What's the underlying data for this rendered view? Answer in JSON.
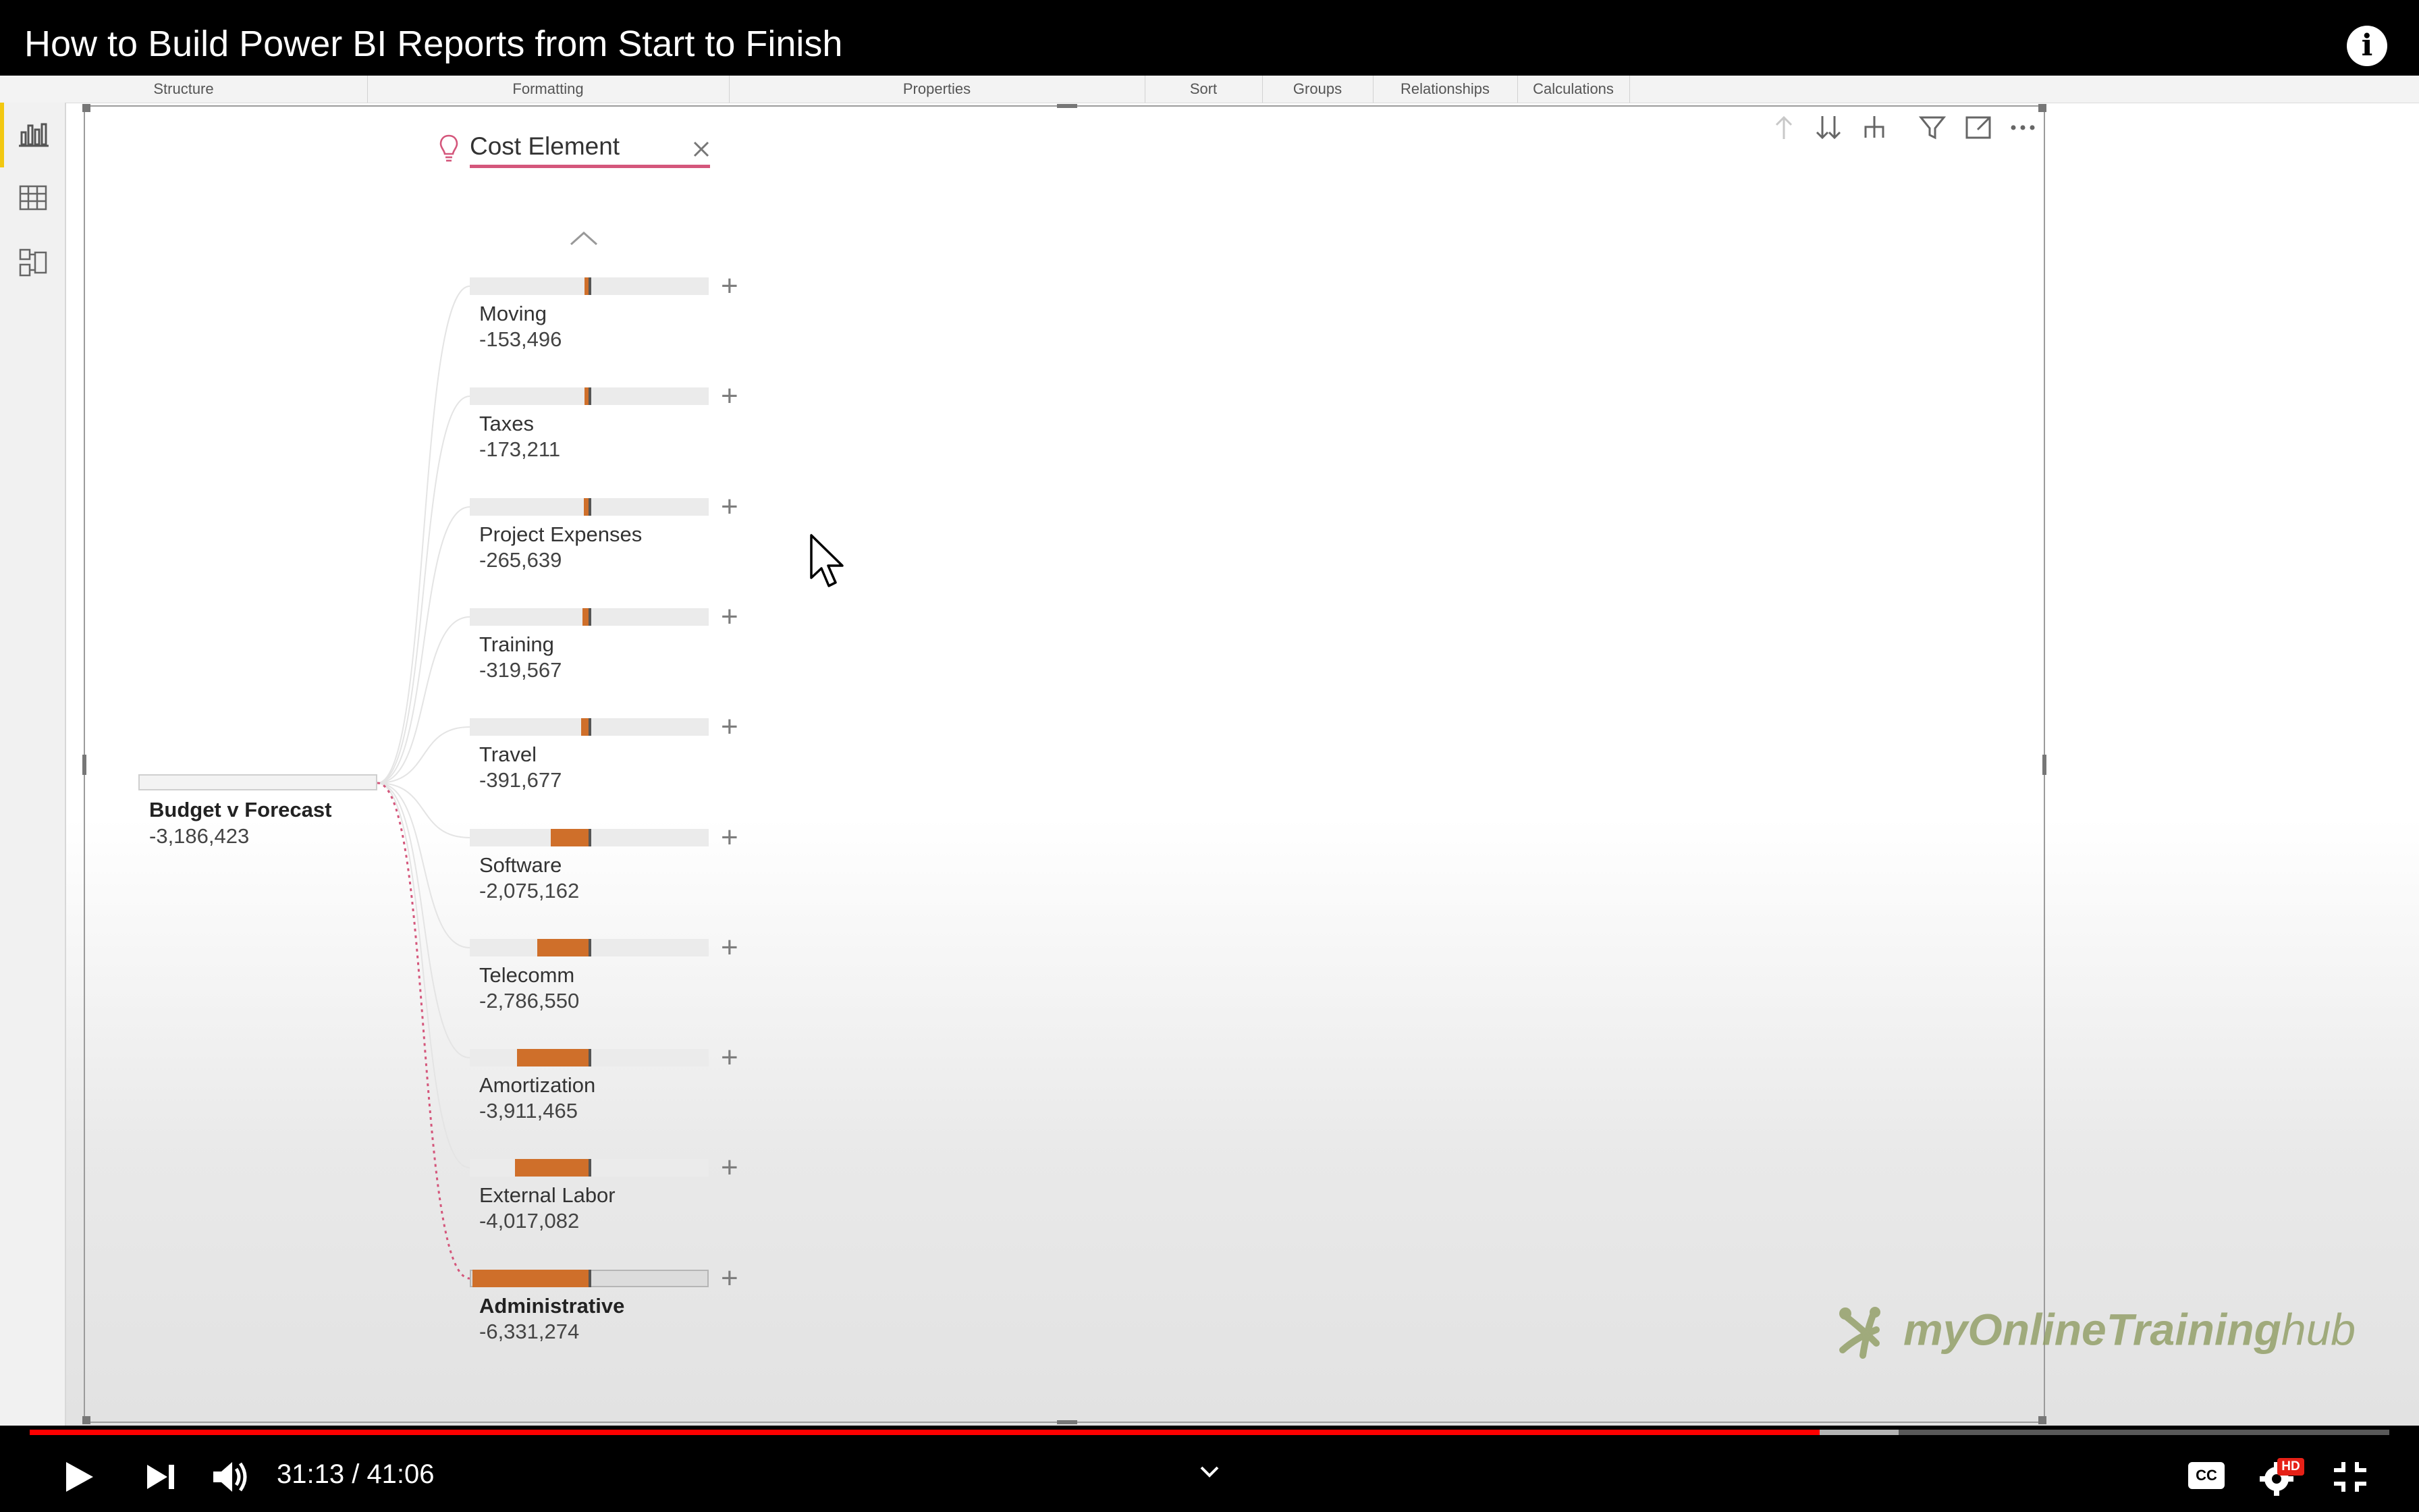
{
  "video": {
    "title": "How to Build Power BI Reports from Start to Finish",
    "current_time": "31:13",
    "duration": "41:06",
    "time_display": "31:13 / 41:06",
    "progress": 0.7585,
    "buffered": 0.792
  },
  "ribbon": {
    "groups": [
      "Structure",
      "Formatting",
      "Properties",
      "Sort",
      "Groups",
      "Relationships",
      "Calculations"
    ]
  },
  "decomp_tree": {
    "level_header": "Cost Element",
    "root": {
      "label": "Budget v Forecast",
      "value": "-3,186,423"
    },
    "bar_scale_max": 6331274,
    "items": [
      {
        "label": "Moving",
        "value": "-153,496",
        "magnitude": 153496,
        "selected": false
      },
      {
        "label": "Taxes",
        "value": "-173,211",
        "magnitude": 173211,
        "selected": false
      },
      {
        "label": "Project Expenses",
        "value": "-265,639",
        "magnitude": 265639,
        "selected": false
      },
      {
        "label": "Training",
        "value": "-319,567",
        "magnitude": 319567,
        "selected": false
      },
      {
        "label": "Travel",
        "value": "-391,677",
        "magnitude": 391677,
        "selected": false
      },
      {
        "label": "Software",
        "value": "-2,075,162",
        "magnitude": 2075162,
        "selected": false
      },
      {
        "label": "Telecomm",
        "value": "-2,786,550",
        "magnitude": 2786550,
        "selected": false
      },
      {
        "label": "Amortization",
        "value": "-3,911,465",
        "magnitude": 3911465,
        "selected": false
      },
      {
        "label": "External Labor",
        "value": "-4,017,082",
        "magnitude": 4017082,
        "selected": false
      },
      {
        "label": "Administrative",
        "value": "-6,331,274",
        "magnitude": 6331274,
        "selected": true
      }
    ]
  },
  "watermark": {
    "part1": "myOnlineTraining",
    "part2": "hub"
  },
  "colors": {
    "bar_fill": "#cf6f2a",
    "accent_underline": "#d4567b",
    "progress": "#ff0000",
    "selected_path": "#d4567b"
  },
  "icons": {
    "rail": [
      "report-view-icon",
      "data-view-icon",
      "model-view-icon"
    ],
    "visual_toolbar": [
      "drill-up-icon",
      "drill-down-all-icon",
      "expand-hierarchy-icon",
      "filter-icon",
      "focus-mode-icon",
      "more-options-icon"
    ],
    "player": [
      "play-icon",
      "next-icon",
      "volume-icon",
      "chapters-chevron-icon",
      "captions-icon",
      "settings-icon",
      "exit-fullscreen-icon"
    ]
  },
  "player_labels": {
    "captions": "CC",
    "hd_badge": "HD"
  }
}
